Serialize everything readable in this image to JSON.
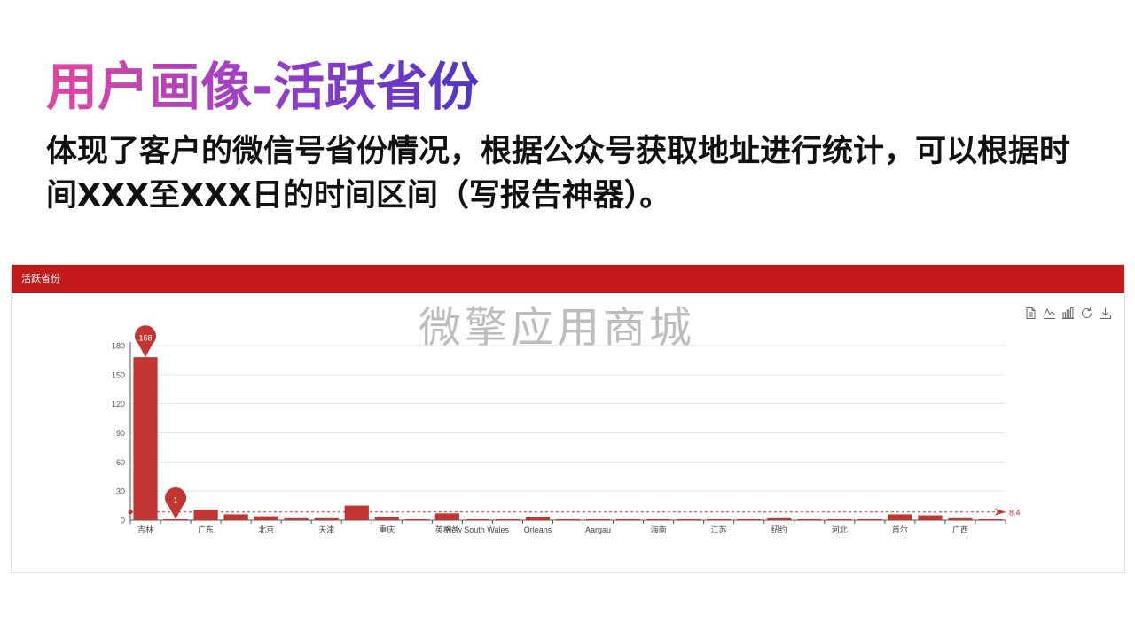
{
  "header": {
    "title": "用户画像-活跃省份",
    "description": "体现了客户的微信号省份情况，根据公众号获取地址进行统计，可以根据时间XXX至XXX日的时间区间（写报告神器）。"
  },
  "panel": {
    "title": "活跃省份",
    "watermark": "微擎应用商城"
  },
  "toolbox": {
    "icons": [
      "data-view-icon",
      "line-chart-icon",
      "bar-chart-icon",
      "restore-icon",
      "download-icon"
    ]
  },
  "colors": {
    "bar": "#c33531",
    "header": "#c21a1a",
    "avg_line": "#c23531"
  },
  "chart_data": {
    "type": "bar",
    "categories": [
      "吉林",
      "",
      "广东",
      "",
      "北京",
      "",
      "天津",
      "",
      "重庆",
      "",
      "英格兰",
      "New South Wales",
      "",
      "Orleans",
      "",
      "Aargau",
      "",
      "海南",
      "",
      "江苏",
      "",
      "纽约",
      "",
      "河北",
      "",
      "首尔",
      "",
      "广西",
      ""
    ],
    "values": [
      168,
      1,
      11,
      6,
      4,
      2,
      2,
      15,
      3,
      1,
      7,
      1,
      1,
      3,
      1,
      1,
      1,
      1,
      1,
      1,
      1,
      2,
      1,
      1,
      1,
      6,
      5,
      2,
      1
    ],
    "ylim": [
      0,
      180
    ],
    "yticks": [
      0,
      30,
      60,
      90,
      120,
      150,
      180
    ],
    "mark_points": [
      {
        "label": "168",
        "index": 0
      },
      {
        "label": "1",
        "index": 1
      }
    ],
    "average_line": {
      "value": 8.4,
      "label": "8.4"
    },
    "grid": true
  }
}
